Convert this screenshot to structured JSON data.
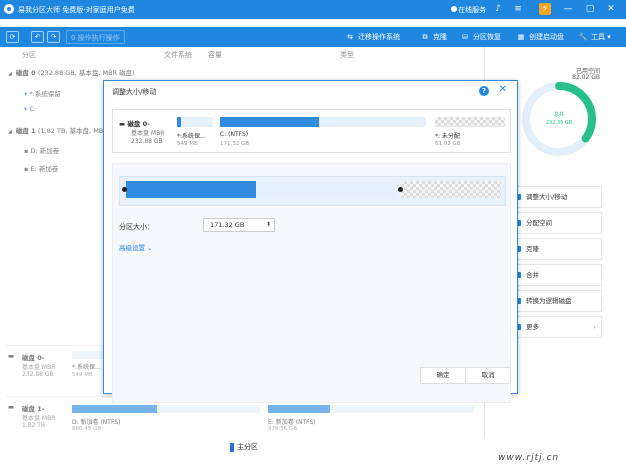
{
  "app": {
    "title": "易我分区大师 免费版-对家庭用户免费",
    "service_label": "在线服务"
  },
  "toolbar": {
    "execute_label": "0 操作执行操作",
    "migrate_label": "迁移操作系统",
    "clone_label": "克隆",
    "recover_label": "分区恢复",
    "bootdisk_label": "创建启动盘",
    "tools_label": "工具"
  },
  "columns": {
    "partition": "分区",
    "filesystem": "文件系统",
    "capacity": "容量",
    "type": "类型"
  },
  "tree": [
    {
      "label": "磁盘 0",
      "detail": "(232.88 GB, 基本盘, MBR 磁盘)",
      "level": 0
    },
    {
      "label": "*:系统保留",
      "detail": "",
      "level": 1
    },
    {
      "label": "C:",
      "detail": "",
      "level": 1
    },
    {
      "label": "磁盘 1",
      "detail": "(1.82 TB, 基本盘, MBR 磁盘)",
      "level": 0
    },
    {
      "label": "D: 新加卷",
      "detail": "",
      "level": 1
    },
    {
      "label": "E: 新加卷",
      "detail": "",
      "level": 1
    }
  ],
  "sidebar": {
    "free_label": "已用空间",
    "free_value": "82.02 GB",
    "total_label": "总共",
    "total_value": "232.35 GB",
    "used_fraction": 0.35,
    "actions": [
      {
        "label": "调整大小/移动"
      },
      {
        "label": "分配空间"
      },
      {
        "label": "克隆"
      },
      {
        "label": "合并"
      },
      {
        "label": "转换为逻辑磁盘"
      },
      {
        "label": "更多"
      }
    ]
  },
  "disk_rows": [
    {
      "name": "磁盘 0-",
      "type": "基本盘 MBR",
      "size": "232.88 GB",
      "first_part_label": "*:系统保...",
      "first_part_size": "549 MB"
    },
    {
      "name": "磁盘 1-",
      "type": "基本盘 MBR",
      "size": "1.82 TB",
      "first_part_label": "D: 新加卷 (NTFS)",
      "first_part_size": "886.45 GB",
      "second_part_label": "E: 新加卷 (NTFS)",
      "second_part_size": "976.56 GB"
    }
  ],
  "legend": {
    "primary": "主分区"
  },
  "dialog": {
    "title": "调整大小/移动",
    "disk_name": "磁盘 0-",
    "disk_type": "基本盘 MBR",
    "disk_size": "232.88 GB",
    "partitions": [
      {
        "label": "*:系统保...",
        "size": "549 MB"
      },
      {
        "label": "C: (NTFS)",
        "size": "171.32 GB"
      },
      {
        "label": "*: 未分配",
        "size": "61.02 GB"
      }
    ],
    "size_label": "分区大小：",
    "size_value": "171.32 GB",
    "advanced_label": "高级设置 ⌄",
    "ok_label": "确定",
    "cancel_label": "取消",
    "slider_fraction": 0.35
  },
  "watermark": "www.rjtj.cn"
}
